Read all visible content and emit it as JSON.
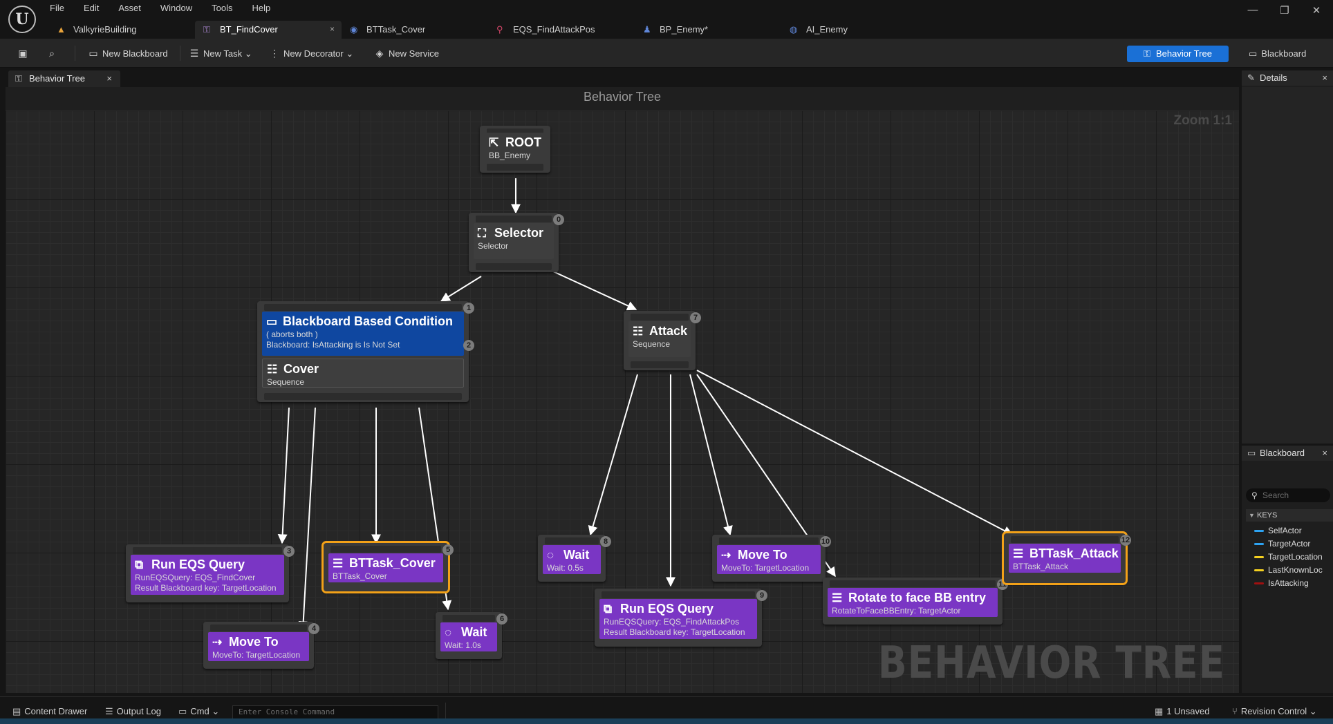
{
  "app": {
    "logo": "U",
    "logo_icon": "unreal-engine-logo"
  },
  "menu": [
    "File",
    "Edit",
    "Asset",
    "Window",
    "Tools",
    "Help"
  ],
  "window_controls": {
    "minimize": "—",
    "restore": "❐",
    "close": "✕"
  },
  "doc_tabs": [
    {
      "label": "ValkyrieBuilding",
      "icon": "level-icon",
      "glyph": "▲",
      "color": "#e8a33b",
      "active": false
    },
    {
      "label": "BT_FindCover",
      "icon": "behavior-tree-icon",
      "glyph": "⚿",
      "color": "#b08ad8",
      "active": true,
      "close": "×"
    },
    {
      "label": "BTTask_Cover",
      "icon": "blueprint-icon",
      "glyph": "◉",
      "color": "#5f86d8",
      "active": false
    },
    {
      "label": "EQS_FindAttackPos",
      "icon": "eqs-icon",
      "glyph": "⚲",
      "color": "#d9486b",
      "active": false
    },
    {
      "label": "BP_Enemy*",
      "icon": "pawn-icon",
      "glyph": "♟",
      "color": "#5f86d8",
      "active": false
    },
    {
      "label": "AI_Enemy",
      "icon": "ai-controller-icon",
      "glyph": "◍",
      "color": "#5f86d8",
      "active": false
    }
  ],
  "toolbar": {
    "save_icon": "save-icon",
    "browse_icon": "browse-icon",
    "new_blackboard": "New Blackboard",
    "new_task": "New Task",
    "new_decorator": "New Decorator",
    "new_service": "New Service",
    "mode_behavior_tree": "Behavior Tree",
    "mode_blackboard": "Blackboard"
  },
  "graph_tab": {
    "label": "Behavior Tree",
    "close": "×"
  },
  "graph": {
    "header": "Behavior Tree",
    "zoom": "Zoom 1:1",
    "watermark": "BEHAVIOR TREE",
    "nodes": {
      "root": {
        "title": "ROOT",
        "sub": "BB_Enemy"
      },
      "selector": {
        "title": "Selector",
        "sub": "Selector",
        "index": "0"
      },
      "decorator": {
        "title": "Blackboard Based Condition",
        "line1": "( aborts both )",
        "line2": "Blackboard: IsAttacking is Is Not Set",
        "index": "1",
        "index2": "2"
      },
      "cover": {
        "title": "Cover",
        "sub": "Sequence"
      },
      "attack": {
        "title": "Attack",
        "sub": "Sequence",
        "index": "7"
      },
      "eqs_cover": {
        "title": "Run EQS Query",
        "line1": "RunEQSQuery: EQS_FindCover",
        "line2": "Result Blackboard key: TargetLocation",
        "index": "3"
      },
      "move_cover": {
        "title": "Move To",
        "sub": "MoveTo: TargetLocation",
        "index": "4"
      },
      "task_cover": {
        "title": "BTTask_Cover",
        "sub": "BTTask_Cover",
        "index": "5"
      },
      "wait_cover": {
        "title": "Wait",
        "sub": "Wait: 1.0s",
        "index": "6"
      },
      "wait_attack": {
        "title": "Wait",
        "sub": "Wait: 0.5s",
        "index": "8"
      },
      "eqs_attack": {
        "title": "Run EQS Query",
        "line1": "RunEQSQuery: EQS_FindAttackPos",
        "line2": "Result Blackboard key: TargetLocation",
        "index": "9"
      },
      "move_attack": {
        "title": "Move To",
        "sub": "MoveTo: TargetLocation",
        "index": "10"
      },
      "rotate": {
        "title": "Rotate to face BB entry",
        "sub": "RotateToFaceBBEntry: TargetActor",
        "index": "11"
      },
      "task_attack": {
        "title": "BTTask_Attack",
        "sub": "BTTask_Attack",
        "index": "12"
      }
    }
  },
  "details_panel": {
    "title": "Details",
    "close": "×"
  },
  "blackboard_panel": {
    "title": "Blackboard",
    "close": "×",
    "search_placeholder": "Search",
    "keys_header": "KEYS",
    "keys": [
      {
        "name": "SelfActor",
        "color": "#2ea3f2"
      },
      {
        "name": "TargetActor",
        "color": "#2ea3f2"
      },
      {
        "name": "TargetLocation",
        "color": "#f5d020"
      },
      {
        "name": "LastKnownLoc",
        "color": "#f5d020"
      },
      {
        "name": "IsAttacking",
        "color": "#a01010"
      }
    ]
  },
  "statusbar": {
    "content_drawer": "Content Drawer",
    "output_log": "Output Log",
    "cmd": "Cmd",
    "console_placeholder": "Enter Console Command",
    "unsaved": "1 Unsaved",
    "revision_control": "Revision Control"
  }
}
